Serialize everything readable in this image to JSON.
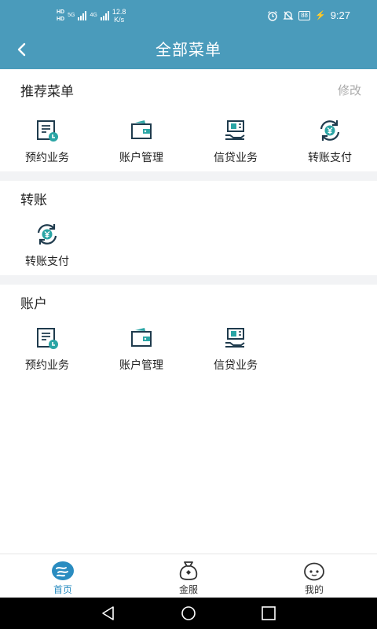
{
  "status_bar": {
    "hd1": "HD",
    "hd2": "HD",
    "net1": "5G",
    "net2": "4G",
    "speed_value": "12.8",
    "speed_unit": "K/s",
    "battery": "88",
    "time": "9:27"
  },
  "header": {
    "title": "全部菜单"
  },
  "sections": {
    "recommended": {
      "title": "推荐菜单",
      "edit_label": "修改",
      "items": [
        {
          "label": "预约业务",
          "icon": "appointment-icon"
        },
        {
          "label": "账户管理",
          "icon": "wallet-icon"
        },
        {
          "label": "信贷业务",
          "icon": "loan-icon"
        },
        {
          "label": "转账支付",
          "icon": "transfer-icon"
        }
      ]
    },
    "transfer": {
      "title": "转账",
      "items": [
        {
          "label": "转账支付",
          "icon": "transfer-icon"
        }
      ]
    },
    "account": {
      "title": "账户",
      "items": [
        {
          "label": "预约业务",
          "icon": "appointment-icon"
        },
        {
          "label": "账户管理",
          "icon": "wallet-icon"
        },
        {
          "label": "信贷业务",
          "icon": "loan-icon"
        }
      ]
    }
  },
  "tabbar": {
    "tabs": [
      {
        "label": "首页",
        "icon": "home-icon",
        "active": true
      },
      {
        "label": "金服",
        "icon": "finance-bag-icon",
        "active": false
      },
      {
        "label": "我的",
        "icon": "profile-face-icon",
        "active": false
      }
    ]
  },
  "colors": {
    "primary": "#4a9bbb",
    "icon_dark": "#1f3b4d",
    "icon_teal": "#2aa5a5",
    "active_tab": "#2a8cc0",
    "divider": "#f2f3f5"
  }
}
